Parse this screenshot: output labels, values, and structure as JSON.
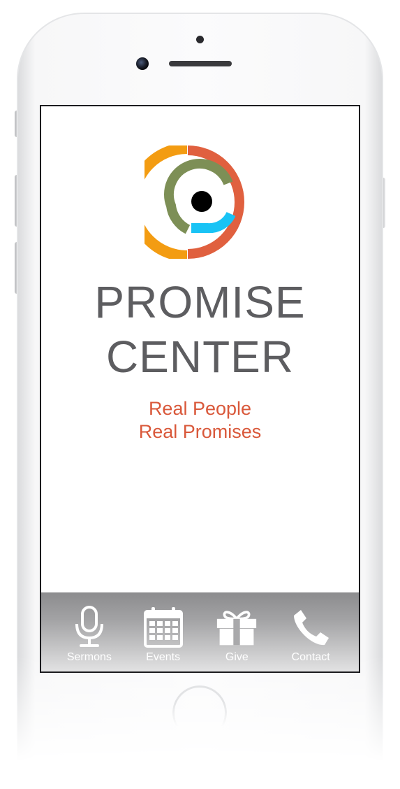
{
  "brand": {
    "line1": "PROMISE",
    "line2": "CENTER",
    "logo_name": "promise-center-logo",
    "title_color": "#5d5d60"
  },
  "tagline": {
    "line1": "Real People",
    "line2": "Real Promises",
    "color": "#d9583a"
  },
  "logo_colors": {
    "orange": "#f39c12",
    "green": "#7d8f56",
    "red": "#e0603f",
    "cyan": "#19c3f5",
    "center": "#000000"
  },
  "tabbar": {
    "items": [
      {
        "label": "Sermons",
        "icon": "microphone-icon"
      },
      {
        "label": "Events",
        "icon": "calendar-icon"
      },
      {
        "label": "Give",
        "icon": "gift-icon"
      },
      {
        "label": "Contact",
        "icon": "phone-icon"
      }
    ]
  }
}
